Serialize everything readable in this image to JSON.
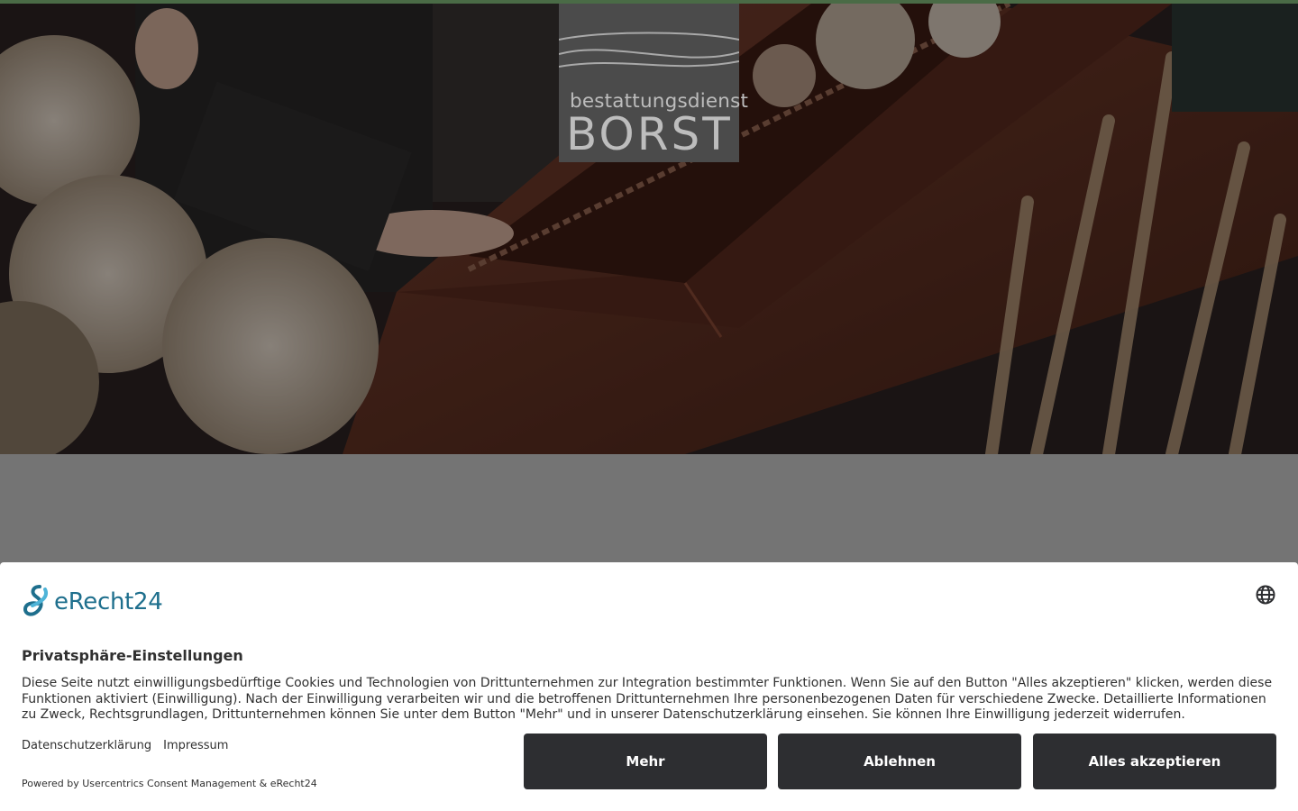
{
  "header": {
    "accent_color": "#4a6b46"
  },
  "logo": {
    "line1": "bestattungsdienst",
    "line2": "BORST",
    "background": "#4b4b4b"
  },
  "hero": {
    "image": "coffin-with-flowers-photo"
  },
  "consent": {
    "brand_name": "eRecht24",
    "language_icon": "globe-icon",
    "title": "Privatsphäre-Einstellungen",
    "text": "Diese Seite nutzt einwilligungsbedürftige Cookies und Technologien von Drittunternehmen zur Integration bestimmter Funktionen. Wenn Sie auf den Button \"Alles akzeptieren\" klicken, werden diese Funktionen aktiviert (Einwilligung). Nach der Einwilligung verarbeiten wir und die betroffenen Drittunternehmen Ihre personenbezogenen Daten für verschiedene Zwecke. Detaillierte Informationen zu Zweck, Rechtsgrundlagen, Drittunternehmen können Sie unter dem Button \"Mehr\" und in unserer Datenschutzerklärung einsehen. Sie können Ihre Einwilligung jederzeit widerrufen.",
    "links": {
      "privacy": "Datenschutzerklärung",
      "imprint": "Impressum"
    },
    "powered_by": "Powered by Usercentrics Consent Management & eRecht24",
    "buttons": {
      "more": "Mehr",
      "decline": "Ablehnen",
      "accept_all": "Alles akzeptieren"
    },
    "brand_color": "#1e6f8d",
    "button_color": "#2d2e31"
  }
}
